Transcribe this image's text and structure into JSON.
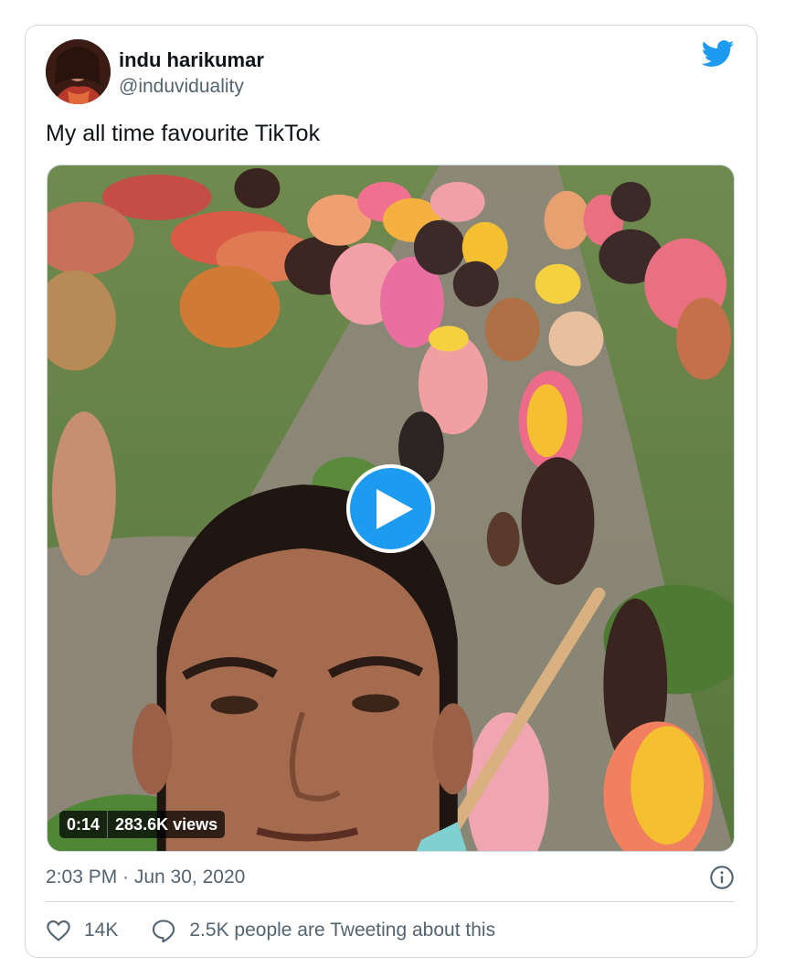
{
  "tweet": {
    "author_name": "indu harikumar",
    "author_handle": "@induviduality",
    "text": "My all time favourite TikTok",
    "timestamp": "2:03 PM · Jun 30, 2020",
    "likes": "14K",
    "conversation": "2.5K people are Tweeting about this"
  },
  "video": {
    "duration": "0:14",
    "views": "283.6K views"
  },
  "colors": {
    "brand_blue": "#1d9bf0",
    "text_primary": "#0f1419",
    "text_secondary": "#536471",
    "border": "#cfd9de"
  },
  "icons": {
    "logo": "twitter-bird-icon",
    "play": "play-icon",
    "info": "info-icon",
    "like": "heart-icon",
    "reply": "speech-bubble-icon"
  }
}
